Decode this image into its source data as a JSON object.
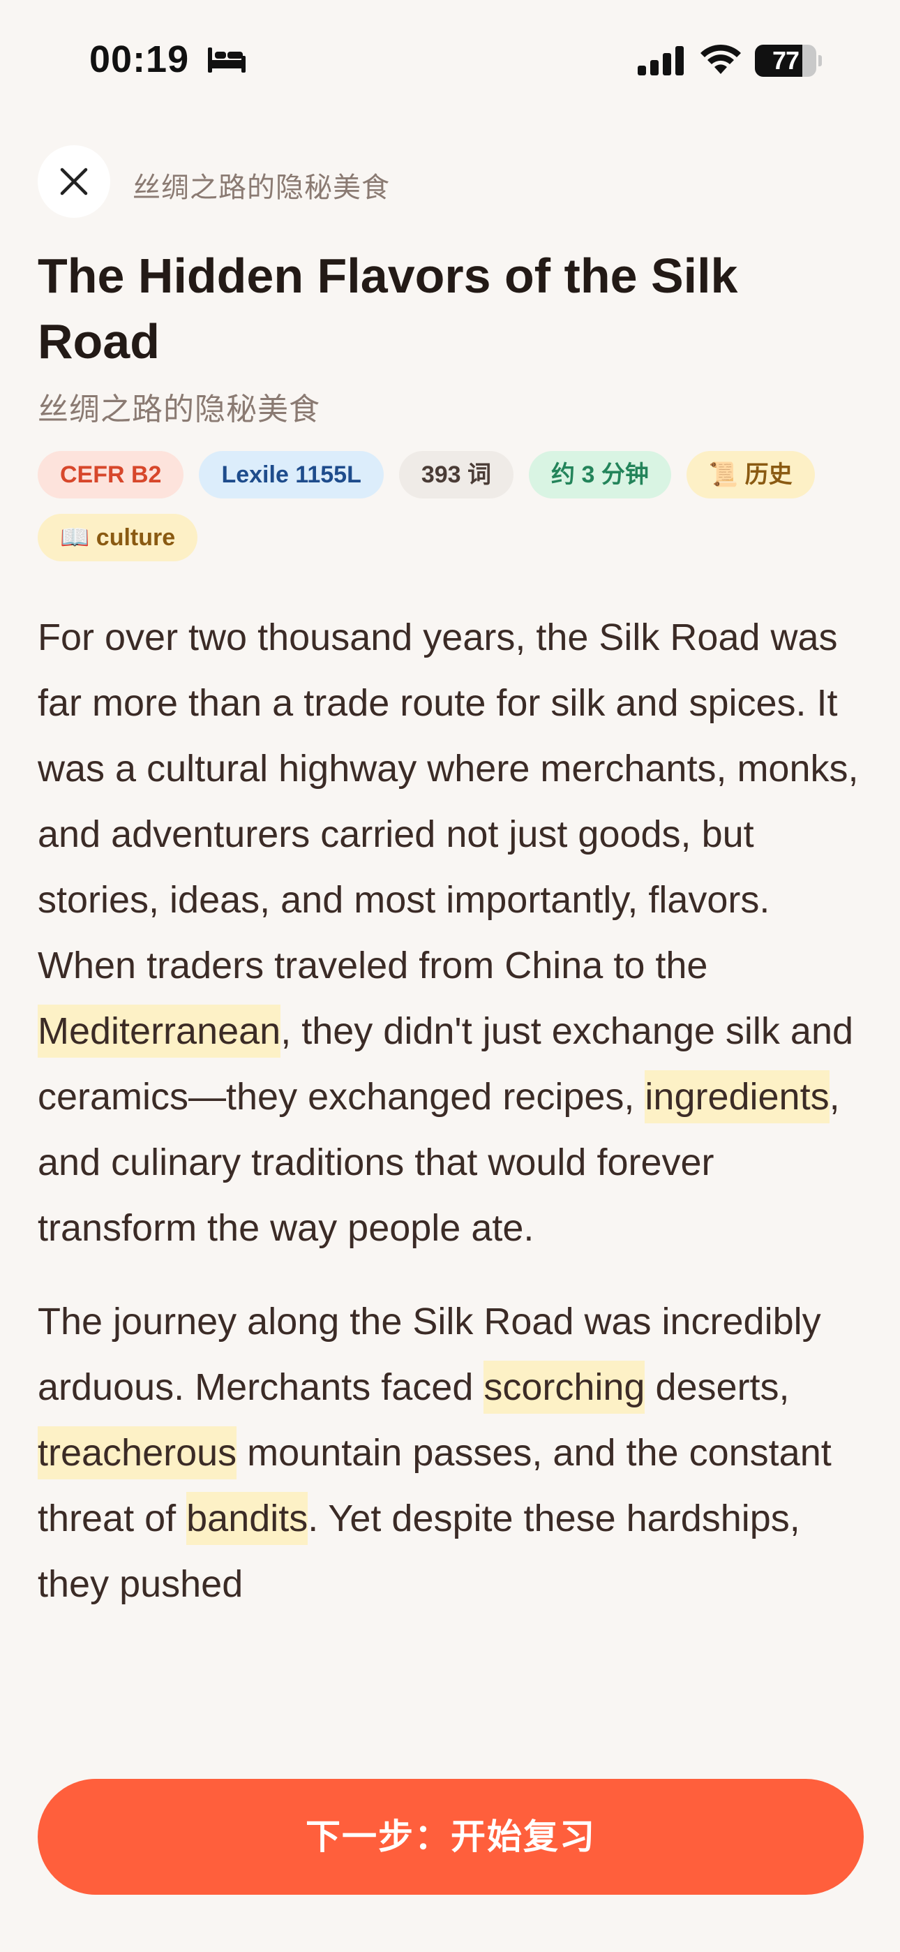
{
  "status_bar": {
    "time": "00:19",
    "battery_level": 77,
    "battery_text": "77"
  },
  "header": {
    "title": "丝绸之路的隐秘美食"
  },
  "article": {
    "title": "The Hidden Flavors of the Silk Road",
    "subtitle": "丝绸之路的隐秘美食",
    "tags": {
      "cefr": "CEFR B2",
      "lexile": "Lexile 1155L",
      "words": "393 词",
      "time": "约 3 分钟",
      "category": "📜 历史",
      "topic": "📖 culture"
    },
    "p1": {
      "s1": "For over two thousand years, the Silk Road was far more than a trade route for silk and spices. It was a cultural highway where merchants, monks, and adventurers carried not just goods, but stories, ideas, and most importantly, flavors. When traders traveled from China to the ",
      "w1": "Mediterranean",
      "s2": ", they didn't just exchange silk and ceramics—they exchanged recipes, ",
      "w2": "ingredients",
      "s3": ", and culinary traditions that would forever transform the way people ate."
    },
    "p2": {
      "s1": "The journey along the Silk Road was incredibly arduous. Merchants faced ",
      "w1": "scorching",
      "s2": " deserts, ",
      "w2": "treacherous",
      "s3": " mountain passes, and the constant threat of ",
      "w3": "bandits",
      "s4": ". Yet despite these hardships, they pushed"
    }
  },
  "cta": {
    "label": "下一步：开始复习"
  },
  "colors": {
    "accent": "#ff5f3c",
    "highlight": "#fdf1c6",
    "background": "#f9f6f3"
  }
}
